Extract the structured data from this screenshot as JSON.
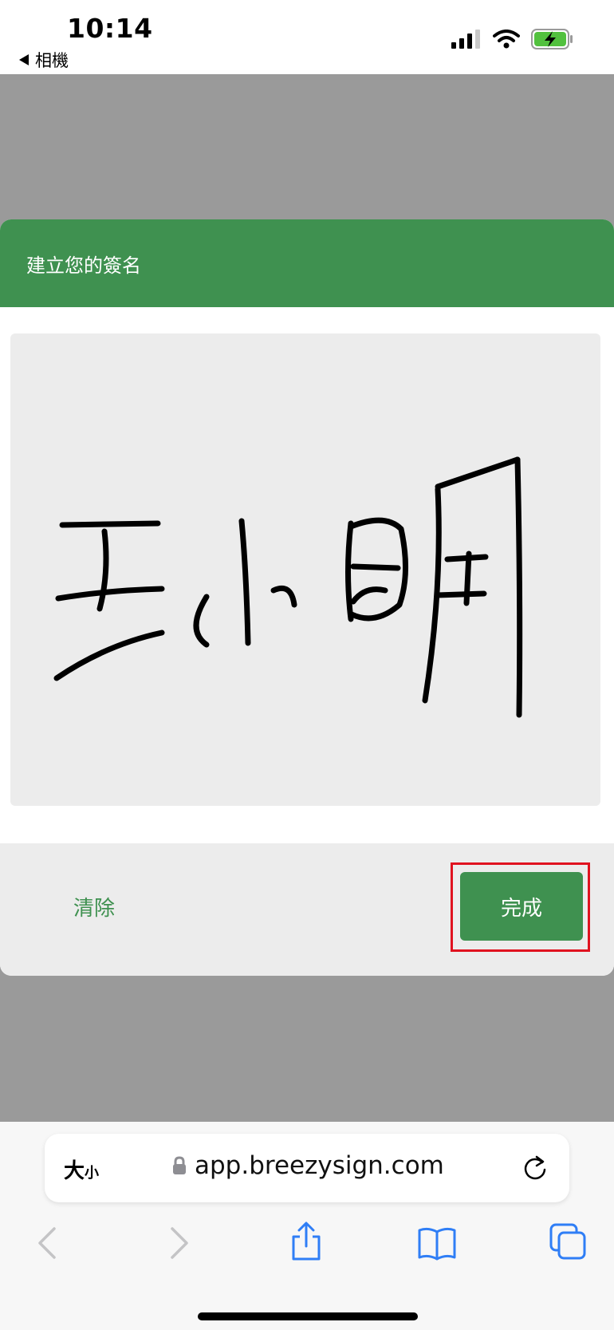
{
  "status_bar": {
    "time": "10:14",
    "back_label": "相機",
    "icons": [
      "signal-icon",
      "wifi-icon",
      "battery-charging-icon"
    ]
  },
  "dialog": {
    "title": "建立您的簽名",
    "clear_label": "清除",
    "done_label": "完成"
  },
  "browser": {
    "text_size_big": "大",
    "text_size_small": "小",
    "url": "app.breezysign.com",
    "icons": [
      "lock-icon",
      "reload-icon",
      "back-icon",
      "forward-icon",
      "share-icon",
      "bookmarks-icon",
      "tabs-icon"
    ]
  },
  "colors": {
    "accent_green": "#3f9150",
    "highlight_red": "#e0121f",
    "overlay_gray": "#9a9a9a",
    "pad_gray": "#ececec",
    "ios_blue": "#2f7ef6"
  }
}
